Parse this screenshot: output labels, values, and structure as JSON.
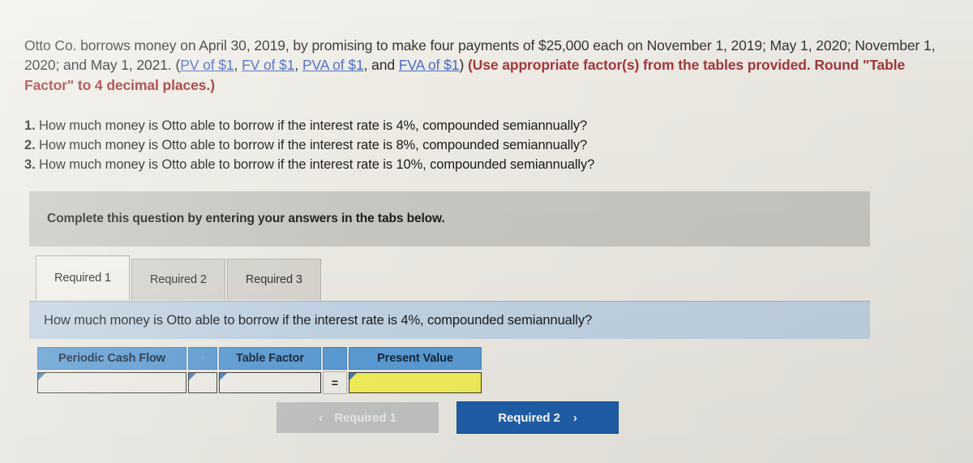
{
  "question": {
    "stem_part1": "Otto Co. borrows money on April 30, 2019, by promising to make four payments of $25,000 each on November 1, 2019; May 1, 2020; November 1, 2020; and May 1, 2021. (",
    "links": [
      {
        "label": "PV of $1"
      },
      {
        "label": "FV of $1"
      },
      {
        "label": "PVA of $1"
      },
      {
        "label": "FVA of $1"
      }
    ],
    "sep_comma": ", ",
    "sep_and": ", and ",
    "stem_part2": ") ",
    "stem_red": "(Use appropriate factor(s) from the tables provided. Round \"Table Factor\" to 4 decimal places.)"
  },
  "requirements": [
    {
      "num": "1.",
      "text": " How much money is Otto able to borrow if the interest rate is 4%, compounded semiannually?"
    },
    {
      "num": "2.",
      "text": " How much money is Otto able to borrow if the interest rate is 8%, compounded semiannually?"
    },
    {
      "num": "3.",
      "text": " How much money is Otto able to borrow if the interest rate is 10%, compounded semiannually?"
    }
  ],
  "complete_bar": {
    "text": "Complete this question by entering your answers in the tabs below."
  },
  "tabs": [
    {
      "label": "Required 1",
      "active": true
    },
    {
      "label": "Required 2",
      "active": false
    },
    {
      "label": "Required 3",
      "active": false
    }
  ],
  "sub_question": {
    "text": "How much money is Otto able to borrow if the interest rate is 4%, compounded semiannually?"
  },
  "answer_table": {
    "headers": {
      "periodic_cash_flow": "Periodic Cash Flow",
      "multiply_operator": "×",
      "table_factor": "Table Factor",
      "equals_header": "",
      "present_value": "Present Value"
    },
    "row": {
      "periodic_cash_flow_value": "",
      "table_factor_value": "",
      "equals_operator": "=",
      "present_value_value": ""
    }
  },
  "navigation": {
    "prev_label": "Required 1",
    "prev_chevron": "‹",
    "next_label": "Required 2",
    "next_chevron": "›"
  },
  "colors": {
    "page_background": "#edebe4",
    "header_blue": "#5b9bd5",
    "highlight_yellow": "#f2f05a",
    "primary_button_blue": "#1f5faa",
    "disabled_button_grey": "#c2c4c4",
    "complete_bar_grey": "#c9c7c1",
    "sub_question_blue": "#c2d4e4",
    "link_blue": "#3b5fc0",
    "red_emphasis": "#9e2a2b"
  }
}
